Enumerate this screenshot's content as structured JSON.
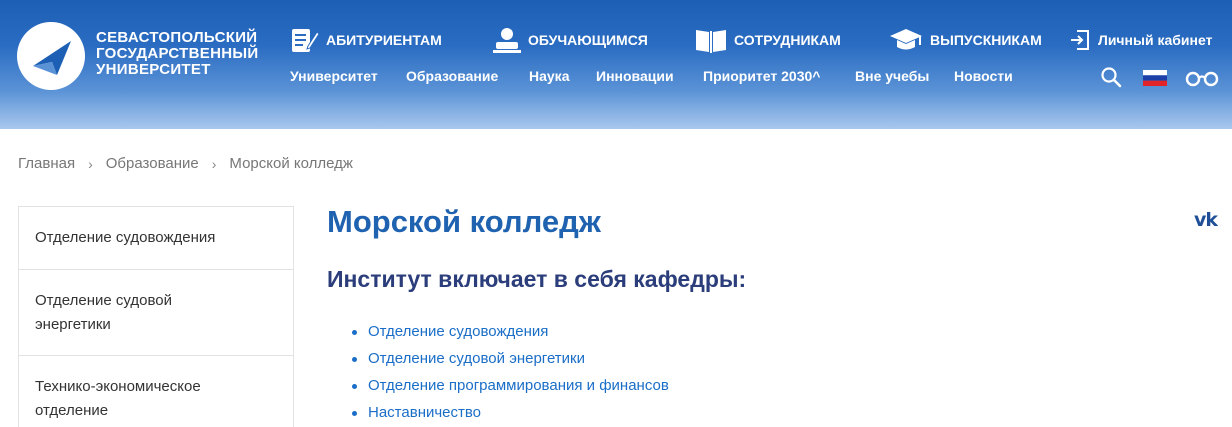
{
  "header": {
    "logo_lines": [
      "СЕВАСТОПОЛЬСКИЙ",
      "ГОСУДАРСТВЕННЫЙ",
      "УНИВЕРСИТЕТ"
    ],
    "top_nav": [
      {
        "label": "АБИТУРИЕНТАМ",
        "icon": "notepad-pen-icon"
      },
      {
        "label": "ОБУЧАЮЩИМСЯ",
        "icon": "student-icon"
      },
      {
        "label": "СОТРУДНИКАМ",
        "icon": "open-book-icon"
      },
      {
        "label": "ВЫПУСКНИКАМ",
        "icon": "graduation-cap-icon"
      },
      {
        "label": "Личный кабинет",
        "icon": "login-icon"
      }
    ],
    "main_nav": [
      "Университет",
      "Образование",
      "Наука",
      "Инновации",
      "Приоритет 2030^",
      "Вне учебы",
      "Новости"
    ],
    "tools": [
      "search-icon",
      "russian-flag-icon",
      "glasses-icon"
    ]
  },
  "breadcrumb": {
    "items": [
      "Главная",
      "Образование",
      "Морской колледж"
    ],
    "separator": "›"
  },
  "sidebar": {
    "items": [
      {
        "label": "Отделение судовождения"
      },
      {
        "label": "Отделение судовой энергетики"
      },
      {
        "label": "Технико-экономическое отделение"
      }
    ]
  },
  "main": {
    "title": "Морской колледж",
    "subtitle": "Институт включает в себя кафедры:",
    "departments": [
      "Отделение судовождения",
      "Отделение судовой энергетики",
      "Отделение программирования и финансов",
      "Наставничество"
    ]
  },
  "social": {
    "vk_label": "vk"
  },
  "colors": {
    "header_top": "#1d5fb5",
    "title": "#1f62b0",
    "subtitle": "#2b3d7a",
    "link": "#1a6ec7"
  }
}
